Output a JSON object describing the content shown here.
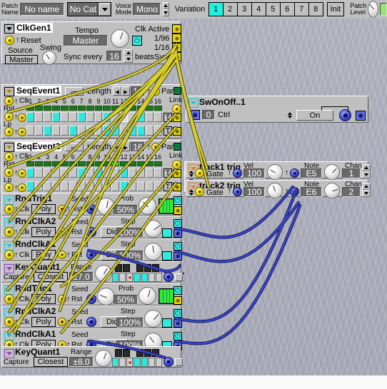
{
  "toolbar": {
    "patch_name_label": "Patch\nName",
    "patch_name_value": "No name",
    "category_value": "No Cat",
    "voice_mode_label": "Voice\nMode",
    "voice_mode_value": "Mono",
    "variation_label": "Variation",
    "variations": [
      "1",
      "2",
      "3",
      "4",
      "5",
      "6",
      "7",
      "8"
    ],
    "variation_active": "1",
    "init_label": "Init",
    "patch_level_label": "Patch\nLevel"
  },
  "modules": {
    "clkgen": {
      "title": "ClkGen1",
      "reset_label": "Reset",
      "source_label": "Source",
      "source_value": "Master",
      "swing_label": "Swing",
      "tempo_label": "Tempo",
      "tempo_value": "Master",
      "sync_every_label": "Sync every",
      "sync_every_value": "16",
      "beats_label": "beats",
      "out_clk_active": "Clk Active",
      "out_96": "1/96",
      "out_16": "1/16",
      "out_sync": "Sync"
    },
    "seq1": {
      "title": "SeqEvent1",
      "clk_label": "Clk",
      "rst_label": "Rst",
      "lp_label": "Lp",
      "length_label": "Length",
      "length_value": "16",
      "park_label": "Park",
      "link_label": "Link",
      "t_label": "T",
      "steps": [
        "1",
        "2",
        "3",
        "4",
        "5",
        "6",
        "7",
        "8",
        "9",
        "10",
        "11",
        "12",
        "13",
        "14",
        "15",
        "16"
      ],
      "position": 12,
      "row_a": [
        1,
        0,
        0,
        1,
        0,
        0,
        1,
        0,
        0,
        1,
        0,
        0,
        0,
        1,
        0,
        0
      ],
      "row_b": [
        0,
        0,
        1,
        0,
        0,
        1,
        0,
        0,
        0,
        1,
        1,
        0,
        1,
        1,
        0,
        0
      ]
    },
    "seq2": {
      "title": "SeqEvent2",
      "clk_label": "Clk",
      "rst_label": "Rst",
      "lp_label": "Lp",
      "length_label": "Length",
      "length_value": "16",
      "park_label": "Park",
      "link_label": "Link",
      "t_label": "T",
      "steps": [
        "1",
        "2",
        "3",
        "4",
        "5",
        "6",
        "7",
        "8",
        "9",
        "10",
        "11",
        "12",
        "13",
        "14",
        "15",
        "16"
      ],
      "position": 11,
      "row_a": [
        1,
        0,
        0,
        0,
        0,
        0,
        1,
        0,
        1,
        0,
        0,
        1,
        0,
        0,
        0,
        0
      ],
      "row_b": [
        1,
        0,
        0,
        0,
        0,
        0,
        0,
        0,
        0,
        0,
        0,
        1,
        0,
        0,
        0,
        0
      ]
    },
    "swonoff": {
      "title": "SwOnOff..1",
      "ctrl_label": "Ctrl",
      "ctrl_value": "0",
      "state_value": "On"
    },
    "track1": {
      "title": "track1 trig",
      "gate_label": "Gate",
      "vel_label": "Vel",
      "vel_value": "100",
      "note_label": "Note",
      "note_value": "E5",
      "chan_label": "Chan",
      "chan_value": "1"
    },
    "track2": {
      "title": "track2 trig",
      "gate_label": "Gate",
      "vel_label": "Vel",
      "vel_value": "100",
      "note_label": "Note",
      "note_value": "E6",
      "chan_label": "Chan",
      "chan_value": "2"
    },
    "rndtrig1a": {
      "title": "RndTrig1",
      "clk_label": "Clk",
      "poly_value": "Poly",
      "rst_label": "Rst",
      "seed_label": "Seed",
      "prob_label": "Prob",
      "prob_value": "50%"
    },
    "rndclka2a": {
      "title": "RndClkA2",
      "clk_label": "Clk",
      "poly_value": "Poly",
      "rst_label": "Rst",
      "seed_label": "Seed",
      "dice_label": "Dice",
      "step_label": "Step",
      "step_value": "100%"
    },
    "rndclka1a": {
      "title": "RndClkA1",
      "clk_label": "Clk",
      "poly_value": "Poly",
      "rst_label": "Rst",
      "seed_label": "Seed",
      "dice_label": "Dice",
      "step_label": "Step",
      "step_value": "100%"
    },
    "keyquant1a": {
      "title": "KeyQuant1",
      "capture_label": "Capture",
      "capture_value": "Closest",
      "range_label": "Range",
      "range_value": "±7.0"
    },
    "rndtrig1b": {
      "title": "RndTrig1",
      "clk_label": "Clk",
      "poly_value": "Poly",
      "rst_label": "Rst",
      "seed_label": "Seed",
      "prob_label": "Prob",
      "prob_value": "50%"
    },
    "rndclka2b": {
      "title": "RndClkA2",
      "clk_label": "Clk",
      "poly_value": "Poly",
      "rst_label": "Rst",
      "seed_label": "Seed",
      "dice_label": "Dice",
      "step_label": "Step",
      "step_value": "100%"
    },
    "rndclka1b": {
      "title": "RndClkA1",
      "clk_label": "Clk",
      "poly_value": "Poly",
      "rst_label": "Rst",
      "seed_label": "Seed",
      "dice_label": "Dice",
      "step_label": "Step",
      "step_value": "100%"
    },
    "keyquant1b": {
      "title": "KeyQuant1",
      "capture_label": "Capture",
      "capture_value": "Closest",
      "range_label": "Range",
      "range_value": "±8.0"
    }
  },
  "colors": {
    "cable_yellow": "#d8cf2c",
    "cable_blue": "#3b46cf",
    "accent_cyan": "#2fe8df",
    "panel": "#c0c0c0",
    "display_bg": "#696969"
  }
}
